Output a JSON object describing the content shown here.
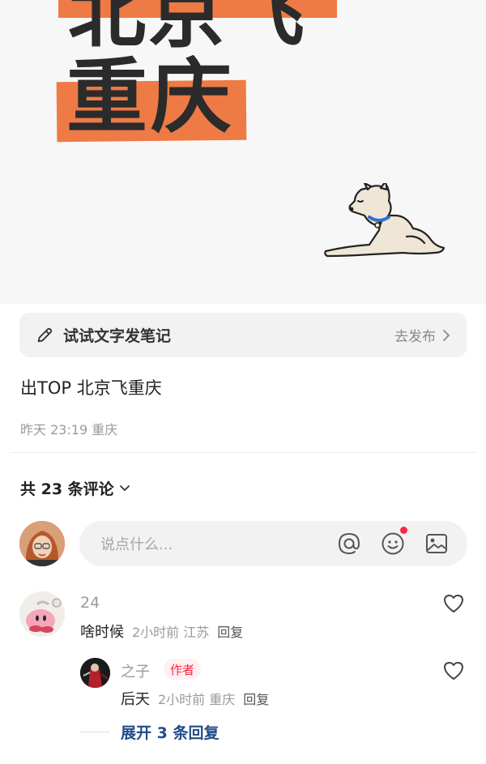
{
  "hero": {
    "line1_text": "北京飞",
    "line2_text": "重庆"
  },
  "compose": {
    "label": "试试文字发笔记",
    "action_label": "去发布",
    "icon": "pencil-icon"
  },
  "post": {
    "title": "出TOP  北京飞重庆",
    "meta": "昨天 23:19 重庆"
  },
  "comments_header": {
    "label": "共 23 条评论"
  },
  "comment_input": {
    "placeholder": "说点什么...",
    "icons": [
      "at-icon",
      "emoji-icon",
      "image-icon"
    ]
  },
  "comments": [
    {
      "name": "24",
      "text": "啥时候",
      "time": "2小时前",
      "location": "江苏",
      "reply_label": "回复"
    },
    {
      "name": "之子",
      "badge": "作者",
      "text": "后天",
      "time": "2小时前",
      "location": "重庆",
      "reply_label": "回复"
    }
  ],
  "expand_label": "展开 3 条回复",
  "colors": {
    "accent_orange": "#ee7a45",
    "badge_red": "#ff2442",
    "link_blue": "#1f4b8a"
  }
}
